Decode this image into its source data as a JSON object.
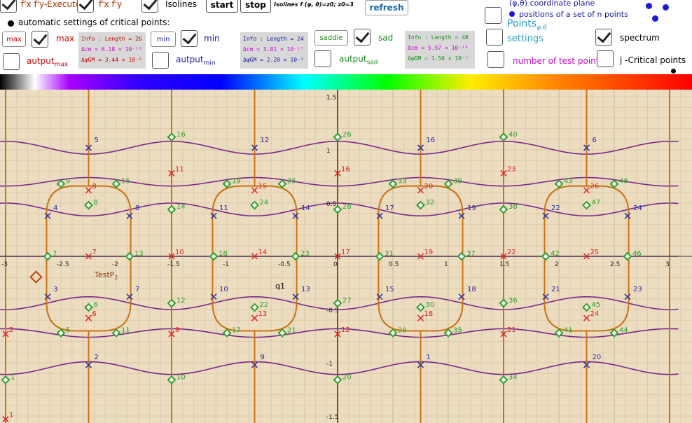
{
  "toolbar": {
    "fxfy_execute": "f'x f'y-Execute",
    "fxfy": "f'x f'y",
    "isolines": "Isolines",
    "start": "start",
    "stop": "stop",
    "isolines_formula": "Isolines f (φ, θ)=z0; z0=3",
    "refresh": "refresh",
    "coordinate_plane": "(φ,θ) coordinate plane",
    "positions_label": "positions of a set of n points",
    "auto_settings": "automatic settings of critical points:",
    "max_btn": "max",
    "max_label": "max",
    "min_btn": "min",
    "min_label": "min",
    "saddle_btn": "saddle",
    "sad_label": "sad",
    "autput_max": "autput",
    "autput_max_sub": "max",
    "autput_min": "autput",
    "autput_min_sub": "min",
    "autput_sad": "autput",
    "autput_sad_sub": "sad",
    "points_label": "Points",
    "points_sub": "φ,θ",
    "settings": "settings",
    "spectrum": "spectrum",
    "num_test_points": "number of test points:",
    "j_critical": "j -Critical points"
  },
  "info_max": {
    "l1": "Info : Length = 26",
    "l2": "Δcm = 6.18 × 10⁻¹⁶",
    "l3": "Δφ̄GM = 3.44 × 10⁻⁹"
  },
  "info_min": {
    "l1": "Info : Length = 24",
    "l2": "Δcm = 3.81 × 10⁻¹⁷",
    "l3": "Δφ̄GM = 2.20 × 10⁻²"
  },
  "info_sad": {
    "l1": "Info : Length = 48",
    "l2": "Δcm = 5.57 × 10⁻¹⁴",
    "l3": "Δφ̄GM = 1.50 × 10⁻²"
  },
  "colors": {
    "max": "#dd2222",
    "min": "#2a2aa0",
    "saddle": "#2ca02c",
    "isoline": "#7a2a8a",
    "orange": "#c87314",
    "bg": "#ecdcc0"
  },
  "plot": {
    "x_ticks": [
      "-3",
      "-2.5",
      "-2",
      "-1.5",
      "-1",
      "-0.5",
      "0",
      "0.5",
      "1",
      "1.5",
      "2",
      "2.5",
      "3"
    ],
    "y_ticks": [
      "1.5",
      "1",
      "0.5",
      "-0.5",
      "-1",
      "-1.5"
    ],
    "test_point_label": "TestP",
    "test_point_sub": "2",
    "q1": "q1"
  },
  "points": {
    "maxima": [
      {
        "n": "1",
        "x": -3.0,
        "y": -1.53
      },
      {
        "n": "2",
        "x": -3.0,
        "y": -0.73
      },
      {
        "n": "11",
        "x": -1.5,
        "y": 0.78
      },
      {
        "n": "10",
        "x": -1.5,
        "y": 0.0
      },
      {
        "n": "9",
        "x": -1.5,
        "y": -0.73
      },
      {
        "n": "16",
        "x": 0.0,
        "y": 0.78
      },
      {
        "n": "17",
        "x": 0.0,
        "y": 0.0
      },
      {
        "n": "12",
        "x": 0.0,
        "y": -0.73
      },
      {
        "n": "23",
        "x": 1.5,
        "y": 0.78
      },
      {
        "n": "22",
        "x": 1.5,
        "y": 0.0
      },
      {
        "n": "21",
        "x": 1.5,
        "y": -0.73
      },
      {
        "n": "8",
        "x": -2.25,
        "y": 0.62
      },
      {
        "n": "7",
        "x": -2.25,
        "y": 0.0
      },
      {
        "n": "6",
        "x": -2.25,
        "y": -0.58
      },
      {
        "n": "15",
        "x": -0.75,
        "y": 0.62
      },
      {
        "n": "14",
        "x": -0.75,
        "y": 0.0
      },
      {
        "n": "13",
        "x": -0.75,
        "y": -0.58
      },
      {
        "n": "20",
        "x": 0.75,
        "y": 0.62
      },
      {
        "n": "19",
        "x": 0.75,
        "y": 0.0
      },
      {
        "n": "18",
        "x": 0.75,
        "y": -0.58
      },
      {
        "n": "26",
        "x": 2.25,
        "y": 0.62
      },
      {
        "n": "25",
        "x": 2.25,
        "y": 0.0
      },
      {
        "n": "24",
        "x": 2.25,
        "y": -0.58
      }
    ],
    "minima": [
      {
        "n": "5",
        "x": -2.25,
        "y": 1.02
      },
      {
        "n": "4",
        "x": -2.62,
        "y": 0.38
      },
      {
        "n": "8",
        "x": -1.88,
        "y": 0.38
      },
      {
        "n": "3",
        "x": -2.62,
        "y": -0.38
      },
      {
        "n": "7",
        "x": -1.88,
        "y": -0.38
      },
      {
        "n": "2",
        "x": -2.25,
        "y": -1.02
      },
      {
        "n": "12",
        "x": -0.75,
        "y": 1.02
      },
      {
        "n": "11",
        "x": -1.12,
        "y": 0.38
      },
      {
        "n": "14",
        "x": -0.38,
        "y": 0.38
      },
      {
        "n": "10",
        "x": -1.12,
        "y": -0.38
      },
      {
        "n": "13",
        "x": -0.38,
        "y": -0.38
      },
      {
        "n": "9",
        "x": -0.75,
        "y": -1.02
      },
      {
        "n": "16",
        "x": 0.75,
        "y": 1.02
      },
      {
        "n": "17",
        "x": 0.38,
        "y": 0.38
      },
      {
        "n": "19",
        "x": 1.12,
        "y": 0.38
      },
      {
        "n": "15",
        "x": 0.38,
        "y": -0.38
      },
      {
        "n": "18",
        "x": 1.12,
        "y": -0.38
      },
      {
        "n": "1",
        "x": 0.75,
        "y": -1.02
      },
      {
        "n": "6",
        "x": 2.25,
        "y": 1.02
      },
      {
        "n": "22",
        "x": 1.88,
        "y": 0.38
      },
      {
        "n": "24",
        "x": 2.62,
        "y": 0.38
      },
      {
        "n": "21",
        "x": 1.88,
        "y": -0.38
      },
      {
        "n": "23",
        "x": 2.62,
        "y": -0.38
      },
      {
        "n": "20",
        "x": 2.25,
        "y": -1.02
      }
    ],
    "saddles": [
      {
        "n": "16",
        "x": -1.5,
        "y": 1.12
      },
      {
        "n": "26",
        "x": 0.0,
        "y": 1.12
      },
      {
        "n": "40",
        "x": 1.5,
        "y": 1.12
      },
      {
        "n": "9",
        "x": -2.5,
        "y": 0.68
      },
      {
        "n": "15",
        "x": -2.0,
        "y": 0.68
      },
      {
        "n": "8",
        "x": -2.25,
        "y": 0.48
      },
      {
        "n": "14",
        "x": -1.5,
        "y": 0.44
      },
      {
        "n": "19",
        "x": -1.0,
        "y": 0.68
      },
      {
        "n": "25",
        "x": -0.5,
        "y": 0.68
      },
      {
        "n": "24",
        "x": -0.75,
        "y": 0.48
      },
      {
        "n": "28",
        "x": 0.0,
        "y": 0.44
      },
      {
        "n": "33",
        "x": 0.5,
        "y": 0.68
      },
      {
        "n": "39",
        "x": 1.0,
        "y": 0.68
      },
      {
        "n": "32",
        "x": 0.75,
        "y": 0.48
      },
      {
        "n": "38",
        "x": 1.5,
        "y": 0.44
      },
      {
        "n": "43",
        "x": 2.0,
        "y": 0.68
      },
      {
        "n": "48",
        "x": 2.5,
        "y": 0.68
      },
      {
        "n": "47",
        "x": 2.25,
        "y": 0.48
      },
      {
        "n": "7",
        "x": -2.62,
        "y": 0.0
      },
      {
        "n": "13",
        "x": -1.88,
        "y": 0.0
      },
      {
        "n": "18",
        "x": -1.12,
        "y": 0.0
      },
      {
        "n": "23",
        "x": -0.38,
        "y": 0.0
      },
      {
        "n": "31",
        "x": 0.38,
        "y": 0.0
      },
      {
        "n": "37",
        "x": 1.12,
        "y": 0.0
      },
      {
        "n": "42",
        "x": 1.88,
        "y": 0.0
      },
      {
        "n": "46",
        "x": 2.62,
        "y": 0.0
      },
      {
        "n": "6",
        "x": -2.25,
        "y": -0.48
      },
      {
        "n": "12",
        "x": -1.5,
        "y": -0.44
      },
      {
        "n": "22",
        "x": -0.75,
        "y": -0.48
      },
      {
        "n": "27",
        "x": 0.0,
        "y": -0.44
      },
      {
        "n": "30",
        "x": 0.75,
        "y": -0.48
      },
      {
        "n": "36",
        "x": 1.5,
        "y": -0.44
      },
      {
        "n": "45",
        "x": 2.25,
        "y": -0.48
      },
      {
        "n": "5",
        "x": -2.5,
        "y": -0.72
      },
      {
        "n": "11",
        "x": -2.0,
        "y": -0.72
      },
      {
        "n": "17",
        "x": -1.0,
        "y": -0.72
      },
      {
        "n": "21",
        "x": -0.5,
        "y": -0.72
      },
      {
        "n": "29",
        "x": 0.5,
        "y": -0.72
      },
      {
        "n": "35",
        "x": 1.0,
        "y": -0.72
      },
      {
        "n": "41",
        "x": 2.0,
        "y": -0.72
      },
      {
        "n": "44",
        "x": 2.5,
        "y": -0.72
      },
      {
        "n": "1",
        "x": -3.0,
        "y": -1.16
      },
      {
        "n": "10",
        "x": -1.5,
        "y": -1.16
      },
      {
        "n": "20",
        "x": 0.0,
        "y": -1.16
      },
      {
        "n": "34",
        "x": 1.5,
        "y": -1.16
      }
    ]
  }
}
